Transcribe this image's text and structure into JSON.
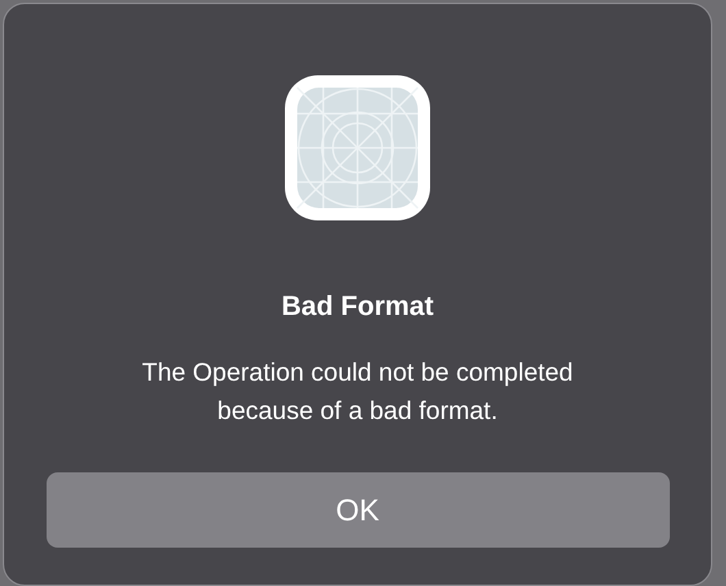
{
  "dialog": {
    "title": "Bad Format",
    "message": "The Operation could not be completed because of a bad format.",
    "buttons": [
      "OK"
    ]
  }
}
